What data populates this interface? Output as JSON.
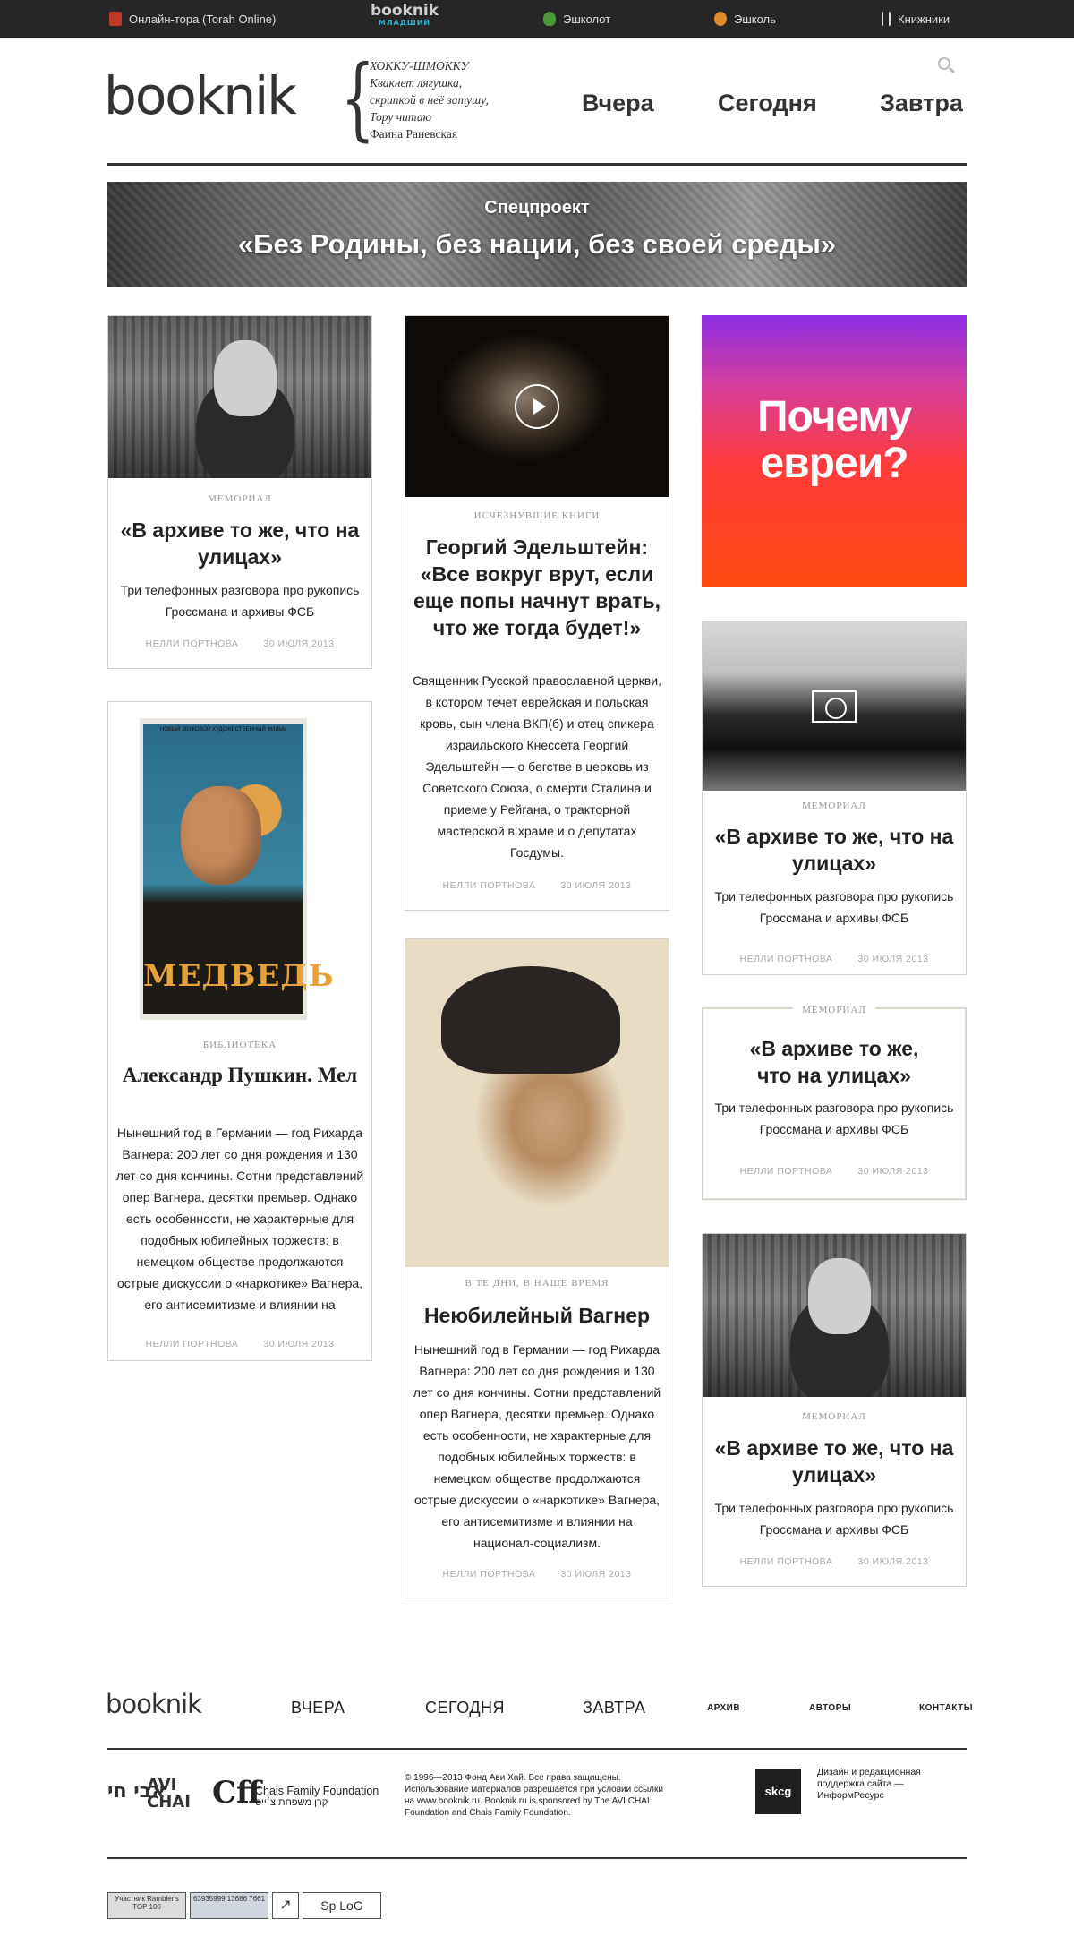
{
  "topbar": {
    "items": [
      {
        "label": "Онлайн-тора (Torah Online)",
        "icon": "torah-icon"
      },
      {
        "label": "Эшколот",
        "icon": "eshkolot-icon"
      },
      {
        "label": "Эшколь",
        "icon": "eshkol-icon"
      },
      {
        "label": "Книжники",
        "icon": "knizhniki-icon"
      }
    ],
    "logo_main": "booknik",
    "logo_sub": "МЛАДШИЙ"
  },
  "header": {
    "logo": "booknik",
    "quote_title": "ХОККУ-ШМОККУ",
    "quote_lines": [
      "Квакнет лягушка,",
      "скрипкой в неё затушу,",
      "Тору читаю"
    ],
    "quote_author": "Фаина Раневская",
    "nav": [
      "Вчера",
      "Сегодня",
      "Завтра"
    ]
  },
  "banner": {
    "kicker": "Спецпроект",
    "title": "«Без Родины, без нации, без своей среды»"
  },
  "cards": [
    {
      "id": "c1",
      "rubric": "МЕМОРИАЛ",
      "title": "«В архиве то же, что на улицах»",
      "desc": "Три телефонных разговора про рукопись Гроссмана и архивы ФСБ",
      "author": "НЕЛЛИ ПОРТНОВА",
      "date": "30 ИЮЛЯ 2013"
    },
    {
      "id": "c2",
      "rubric": "ИСЧЕЗНУВШИЕ КНИГИ",
      "title": "Георгий Эдельштейн: «Все вокруг врут, если еще попы начнут врать, что же тогда будет!»",
      "desc": "Священник Русской православной церкви, в котором течет еврейская и польская кровь, сын члена ВКП(б) и отец спикера израильского Кнессета Георгий Эдельштейн — о бегстве в церковь из Советского Союза, о смерти Сталина и приеме у Рейгана, о тракторной мастерской в храме и о депутатах Госдумы.",
      "author": "НЕЛЛИ ПОРТНОВА",
      "date": "30 ИЮЛЯ 2013"
    },
    {
      "id": "c3",
      "promo": "Почему евреи?"
    },
    {
      "id": "c4",
      "rubric": "МЕМОРИАЛ",
      "title": "«В архиве то же, что на улицах»",
      "desc": "Три телефонных разговора про рукопись Гроссмана и архивы ФСБ",
      "author": "НЕЛЛИ ПОРТНОВА",
      "date": "30 ИЮЛЯ 2013"
    },
    {
      "id": "c5",
      "rubric": "БИБЛИОТЕКА",
      "title": "Александр Пушкин. Мел",
      "desc": "Нынешний год в Германии — год Рихарда Вагнера: 200 лет со дня рождения и 130 лет со дня кончины. Сотни представлений опер Вагнера, десятки премьер. Однако есть особенности, не характерные для подобных юбилейных торжеств: в немецком обществе продолжаются острые дискуссии о «наркотике» Вагнера, его антисемитизме и влиянии на",
      "author": "НЕЛЛИ ПОРТНОВА",
      "date": "30 ИЮЛЯ 2013",
      "poster_word": "МЕДВЕДЬ",
      "poster_top": "НОВЫЙ ЗВУКОВОЙ ХУДОЖЕСТВЕННЫЙ ФИЛЬМ"
    },
    {
      "id": "c6",
      "rubric": "МЕМОРИАЛ",
      "title": "«В архиве то же, что на улицах»",
      "desc": "Три телефонных разговора про рукопись Гроссмана и архивы ФСБ",
      "author": "НЕЛЛИ ПОРТНОВА",
      "date": "30 ИЮЛЯ 2013"
    },
    {
      "id": "c7",
      "rubric": "В ТЕ ДНИ, В НАШЕ ВРЕМЯ",
      "title": "Неюбилейный Вагнер",
      "desc": "Нынешний год в Германии — год Рихарда Вагнера: 200 лет со дня рождения и 130 лет со дня кончины. Сотни представлений опер Вагнера, десятки премьер. Однако есть особенности, не характерные для подобных юбилейных торжеств: в немецком обществе продолжаются острые дискуссии о «наркотике» Вагнера, его антисемитизме и влиянии на национал-социализм.",
      "author": "НЕЛЛИ ПОРТНОВА",
      "date": "30 ИЮЛЯ 2013"
    },
    {
      "id": "c8",
      "rubric": "МЕМОРИАЛ",
      "title": "«В архиве то же, что на улицах»",
      "desc": "Три телефонных разговора про рукопись Гроссмана и архивы ФСБ",
      "author": "НЕЛЛИ ПОРТНОВА",
      "date": "30 ИЮЛЯ 2013"
    }
  ],
  "footer": {
    "logo": "booknik",
    "nav": [
      "ВЧЕРА",
      "СЕГОДНЯ",
      "ЗАВТРА"
    ],
    "small_nav": [
      "АРХИВ",
      "АВТОРЫ",
      "КОНТАКТЫ"
    ],
    "avi_logo": "AVI CHAI",
    "avi_heb": "אבי חי",
    "chais_name": "Chais Family Foundation",
    "chais_heb": "קרן משפחת צ׳ייס",
    "copyright": "© 1996—2013 Фонд Ави Хай. Все права защищены. Использование материалов разрешается при условии ссылки на www.booknik.ru. Booknik.ru is sponsored by The AVI CHAI Foundation and Chais Family Foundation.",
    "skcg": "skcg",
    "design_credit": "Дизайн и редакционная поддержка сайта — ИнформРесурс",
    "counters": [
      "Участник Rambler's TOP 100",
      "63935999 13686 7661",
      "Sp LoG"
    ]
  },
  "colors": {
    "topbar_bg": "#262626",
    "text": "#222222",
    "muted": "#999999",
    "promo_start": "#8a2be2",
    "promo_end": "#ff4b10"
  }
}
